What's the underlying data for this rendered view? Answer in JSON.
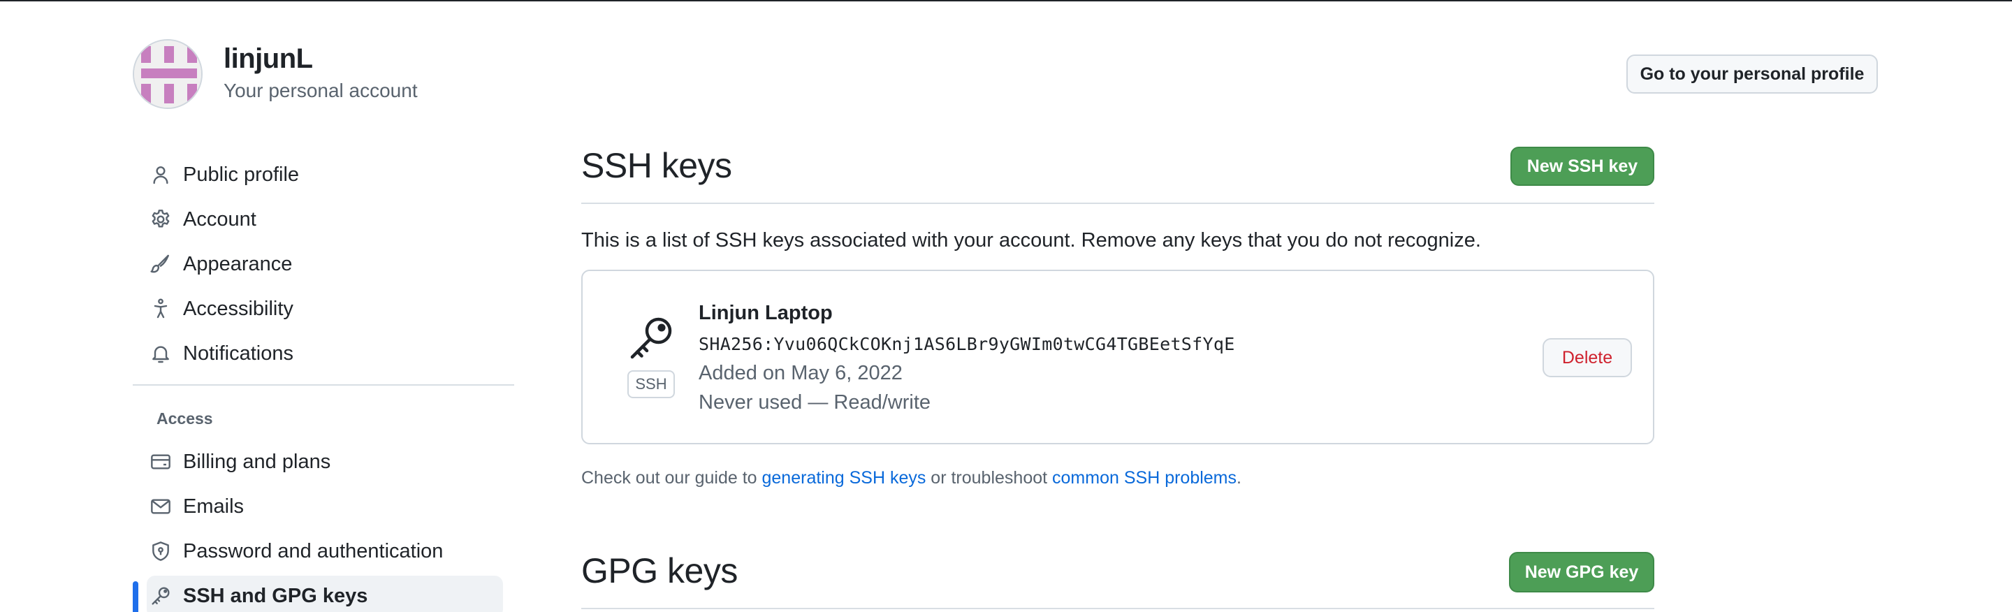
{
  "colors": {
    "primary_button": "#4d9e56",
    "link": "#0969da",
    "danger": "#cf222e",
    "active_nav_marker": "#1f6feb",
    "avatar_pattern": "#c77fbf"
  },
  "header": {
    "username": "linjunL",
    "subtitle": "Your personal account",
    "profile_button": "Go to your personal profile"
  },
  "sidebar": {
    "items": [
      {
        "label": "Public profile",
        "icon": "person-icon"
      },
      {
        "label": "Account",
        "icon": "gear-icon"
      },
      {
        "label": "Appearance",
        "icon": "paintbrush-icon"
      },
      {
        "label": "Accessibility",
        "icon": "accessibility-icon"
      },
      {
        "label": "Notifications",
        "icon": "bell-icon"
      }
    ],
    "access_heading": "Access",
    "access_items": [
      {
        "label": "Billing and plans",
        "icon": "credit-card-icon"
      },
      {
        "label": "Emails",
        "icon": "mail-icon"
      },
      {
        "label": "Password and authentication",
        "icon": "shield-lock-icon"
      },
      {
        "label": "SSH and GPG keys",
        "icon": "key-icon",
        "active": true
      }
    ]
  },
  "ssh": {
    "title": "SSH keys",
    "new_button": "New SSH key",
    "intro": "This is a list of SSH keys associated with your account. Remove any keys that you do not recognize.",
    "key": {
      "name": "Linjun Laptop",
      "fingerprint": "SHA256:Yvu06QCkCOKnj1AS6LBr9yGWIm0twCG4TGBEetSfYqE",
      "added": "Added on May 6, 2022",
      "usage": "Never used — Read/write",
      "type_tag": "SSH",
      "delete_label": "Delete"
    },
    "guide": {
      "prefix": "Check out our guide to ",
      "link1": "generating SSH keys",
      "middle": " or troubleshoot ",
      "link2": "common SSH problems",
      "suffix": "."
    }
  },
  "gpg": {
    "title": "GPG keys",
    "new_button": "New GPG key"
  }
}
